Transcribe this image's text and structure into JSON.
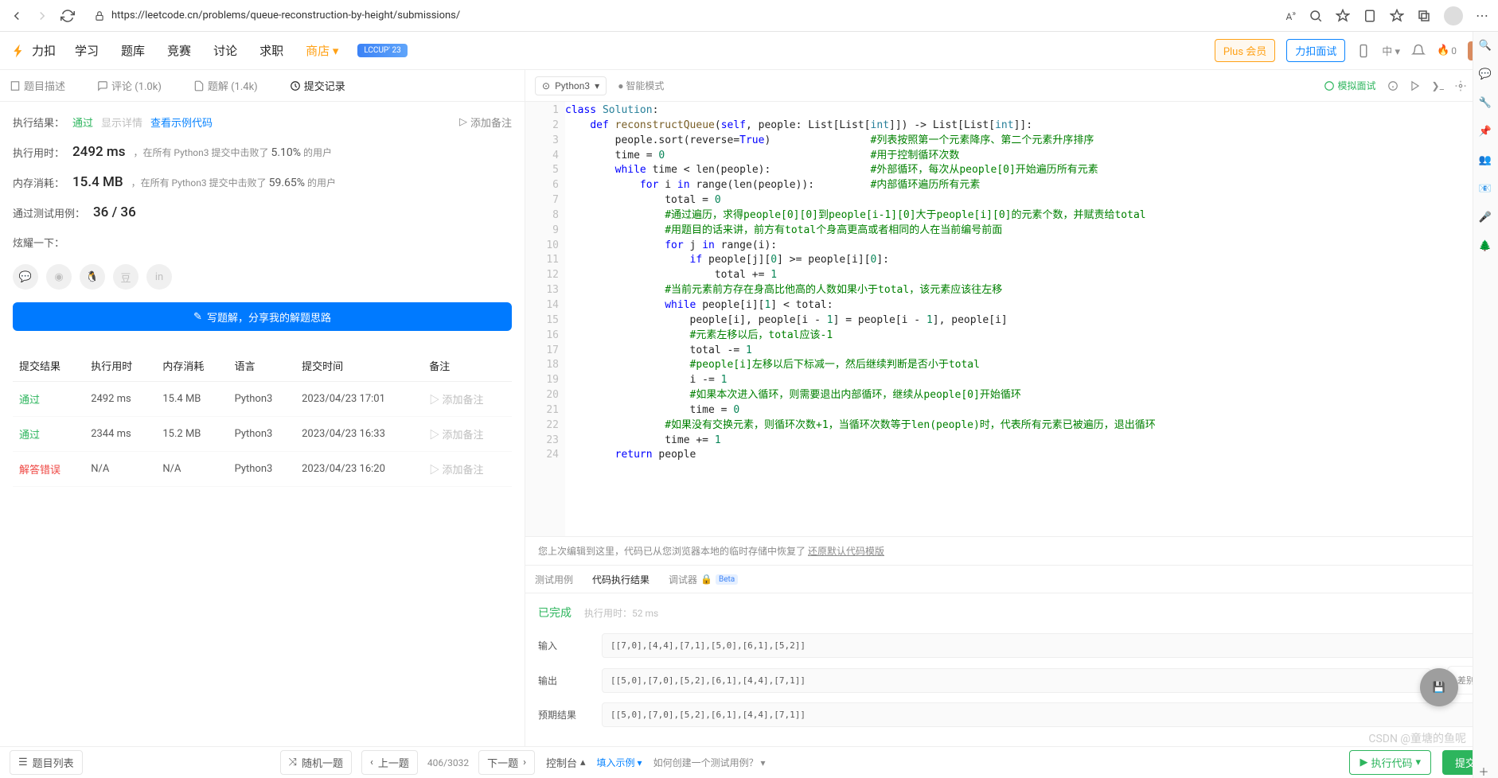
{
  "browser": {
    "url": "https://leetcode.cn/problems/queue-reconstruction-by-height/submissions/"
  },
  "header": {
    "logo": "力扣",
    "nav": {
      "learn": "学习",
      "problems": "题库",
      "contest": "竞赛",
      "discuss": "讨论",
      "jobs": "求职",
      "shop": "商店"
    },
    "lccup": "LCCUP' 23",
    "plus": "Plus 会员",
    "interview": "力扣面试",
    "lang": "中",
    "notif_count": "0"
  },
  "tabs": {
    "desc": "题目描述",
    "comments": "评论 (1.0k)",
    "solutions": "题解 (1.4k)",
    "submissions": "提交记录"
  },
  "result": {
    "exec_label": "执行结果：",
    "pass": "通过",
    "show_detail": "显示详情",
    "view_sample": "查看示例代码",
    "add_note": "添加备注",
    "time_label": "执行用时：",
    "time_val": "2492 ms",
    "time_sub": "，在所有 Python3 提交中击败了",
    "time_pct": "5.10%",
    "time_suffix": "的用户",
    "mem_label": "内存消耗：",
    "mem_val": "15.4 MB",
    "mem_sub": "，在所有 Python3 提交中击败了",
    "mem_pct": "59.65%",
    "mem_suffix": "的用户",
    "cases_label": "通过测试用例：",
    "cases_val": "36 / 36",
    "show_off": "炫耀一下：",
    "write_btn": "写题解，分享我的解题思路"
  },
  "table": {
    "headers": {
      "status": "提交结果",
      "time": "执行用时",
      "mem": "内存消耗",
      "lang": "语言",
      "when": "提交时间",
      "note": "备注"
    },
    "rows": [
      {
        "status": "通过",
        "status_class": "pass",
        "time": "2492 ms",
        "mem": "15.4 MB",
        "lang": "Python3",
        "when": "2023/04/23 17:01",
        "note": "添加备注"
      },
      {
        "status": "通过",
        "status_class": "pass",
        "time": "2344 ms",
        "mem": "15.2 MB",
        "lang": "Python3",
        "when": "2023/04/23 16:33",
        "note": "添加备注"
      },
      {
        "status": "解答错误",
        "status_class": "err",
        "time": "N/A",
        "mem": "N/A",
        "lang": "Python3",
        "when": "2023/04/23 16:20",
        "note": "添加备注"
      }
    ]
  },
  "editor": {
    "lang": "Python3",
    "smart": "智能模式",
    "mock": "模拟面试"
  },
  "code_lines": [
    {
      "n": "1",
      "html": "<span class='kw'>class</span> <span class='typ'>Solution</span>:"
    },
    {
      "n": "2",
      "html": "    <span class='kw'>def</span> <span class='fn'>reconstructQueue</span>(<span class='kw'>self</span>, people: List[List[<span class='typ'>int</span>]]) -> List[List[<span class='typ'>int</span>]]:"
    },
    {
      "n": "3",
      "html": "        people.sort(reverse=<span class='kw'>True</span>)                <span class='cmt'>#列表按照第一个元素降序、第二个元素升序排序</span>"
    },
    {
      "n": "4",
      "html": "        time = <span class='num'>0</span>                                 <span class='cmt'>#用于控制循环次数</span>"
    },
    {
      "n": "5",
      "html": "        <span class='kw'>while</span> time &lt; len(people):                <span class='cmt'>#外部循环，每次从people[0]开始遍历所有元素</span>"
    },
    {
      "n": "6",
      "html": "            <span class='kw'>for</span> i <span class='kw'>in</span> range(len(people)):         <span class='cmt'>#内部循环遍历所有元素</span>"
    },
    {
      "n": "7",
      "html": "                total = <span class='num'>0</span>"
    },
    {
      "n": "8",
      "html": "                <span class='cmt'>#通过遍历，求得people[0][0]到people[i-1][0]大于people[i][0]的元素个数，并赋责给total</span>"
    },
    {
      "n": "9",
      "html": "                <span class='cmt'>#用题目的话来讲，前方有total个身高更高或者相同的人在当前编号前面</span>"
    },
    {
      "n": "10",
      "html": "                <span class='kw'>for</span> j <span class='kw'>in</span> range(i):"
    },
    {
      "n": "11",
      "html": "                    <span class='kw'>if</span> people[j][<span class='num'>0</span>] &gt;= people[i][<span class='num'>0</span>]:"
    },
    {
      "n": "12",
      "html": "                        total += <span class='num'>1</span>"
    },
    {
      "n": "13",
      "html": "                <span class='cmt'>#当前元素前方存在身高比他高的人数如果小于total，该元素应该往左移</span>"
    },
    {
      "n": "14",
      "html": "                <span class='kw'>while</span> people[i][<span class='num'>1</span>] &lt; total:"
    },
    {
      "n": "15",
      "html": "                    people[i], people[i - <span class='num'>1</span>] = people[i - <span class='num'>1</span>], people[i]"
    },
    {
      "n": "16",
      "html": "                    <span class='cmt'>#元素左移以后，total应该-1</span>"
    },
    {
      "n": "17",
      "html": "                    total -= <span class='num'>1</span>"
    },
    {
      "n": "18",
      "html": "                    <span class='cmt'>#people[i]左移以后下标减一，然后继续判断是否小于total</span>"
    },
    {
      "n": "19",
      "html": "                    i -= <span class='num'>1</span>"
    },
    {
      "n": "20",
      "html": "                    <span class='cmt'>#如果本次进入循环，则需要退出内部循环，继续从people[0]开始循环</span>"
    },
    {
      "n": "21",
      "html": "                    time = <span class='num'>0</span>"
    },
    {
      "n": "22",
      "html": "                <span class='cmt'>#如果没有交换元素，则循环次数+1，当循环次数等于len(people)时，代表所有元素已被遍历，退出循环</span>"
    },
    {
      "n": "23",
      "html": "                time += <span class='num'>1</span>"
    },
    {
      "n": "24",
      "html": "        <span class='kw'>return</span> people"
    }
  ],
  "notice": {
    "text": "您上次编辑到这里，代码已从您浏览器本地的临时存储中恢复了",
    "restore": "还原默认代码模版"
  },
  "bottom_tabs": {
    "t1": "测试用例",
    "t2": "代码执行结果",
    "t3": "调试器",
    "beta": "Beta"
  },
  "exec": {
    "done": "已完成",
    "rt_label": "执行用时：",
    "rt_val": "52 ms",
    "input_label": "输入",
    "input_val": "[[7,0],[4,4],[7,1],[5,0],[6,1],[5,2]]",
    "output_label": "输出",
    "output_val": "[[5,0],[7,0],[5,2],[6,1],[4,4],[7,1]]",
    "expected_label": "预期结果",
    "expected_val": "[[5,0],[7,0],[5,2],[6,1],[4,4],[7,1]]",
    "diff": "差别"
  },
  "footer": {
    "list": "题目列表",
    "random": "随机一题",
    "prev": "上一题",
    "page": "406/3032",
    "next": "下一题",
    "console": "控制台",
    "fill": "填入示例",
    "help": "如何创建一个测试用例？",
    "run": "执行代码",
    "submit": "提交"
  },
  "watermark": "CSDN @童塘的鱼呢"
}
